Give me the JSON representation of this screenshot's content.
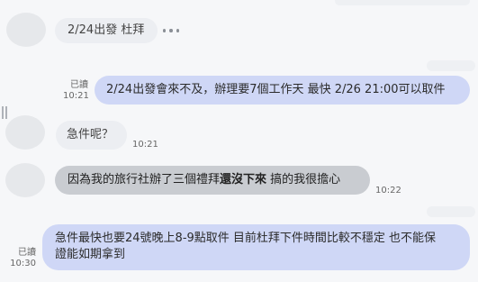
{
  "messages": [
    {
      "text": "2/24出發 杜拜"
    },
    {
      "text": "2/24出發會來不及，辦理要7個工作天 最快 2/26 21:00可以取件",
      "read": "已讀",
      "time": "10:21"
    },
    {
      "text": "急件呢？",
      "time": "10:21"
    },
    {
      "text_a": "因為我的旅行社辦了三個禮拜",
      "text_b": "還沒下來",
      "text_c": " 搞的我很擔心",
      "time": "10:22"
    },
    {
      "line1": "急件最快也要24號晚上8-9點取件 目前杜拜下件時間比較不穩定 也不能保",
      "line2": "證能如期拿到",
      "read": "已讀",
      "time": "10:30"
    }
  ],
  "icons": {
    "more": "more-dots-icon"
  },
  "colors": {
    "outgoing": "#cfd7f6",
    "incoming": "#eceef2",
    "highlighted": "#c9ccd1"
  }
}
